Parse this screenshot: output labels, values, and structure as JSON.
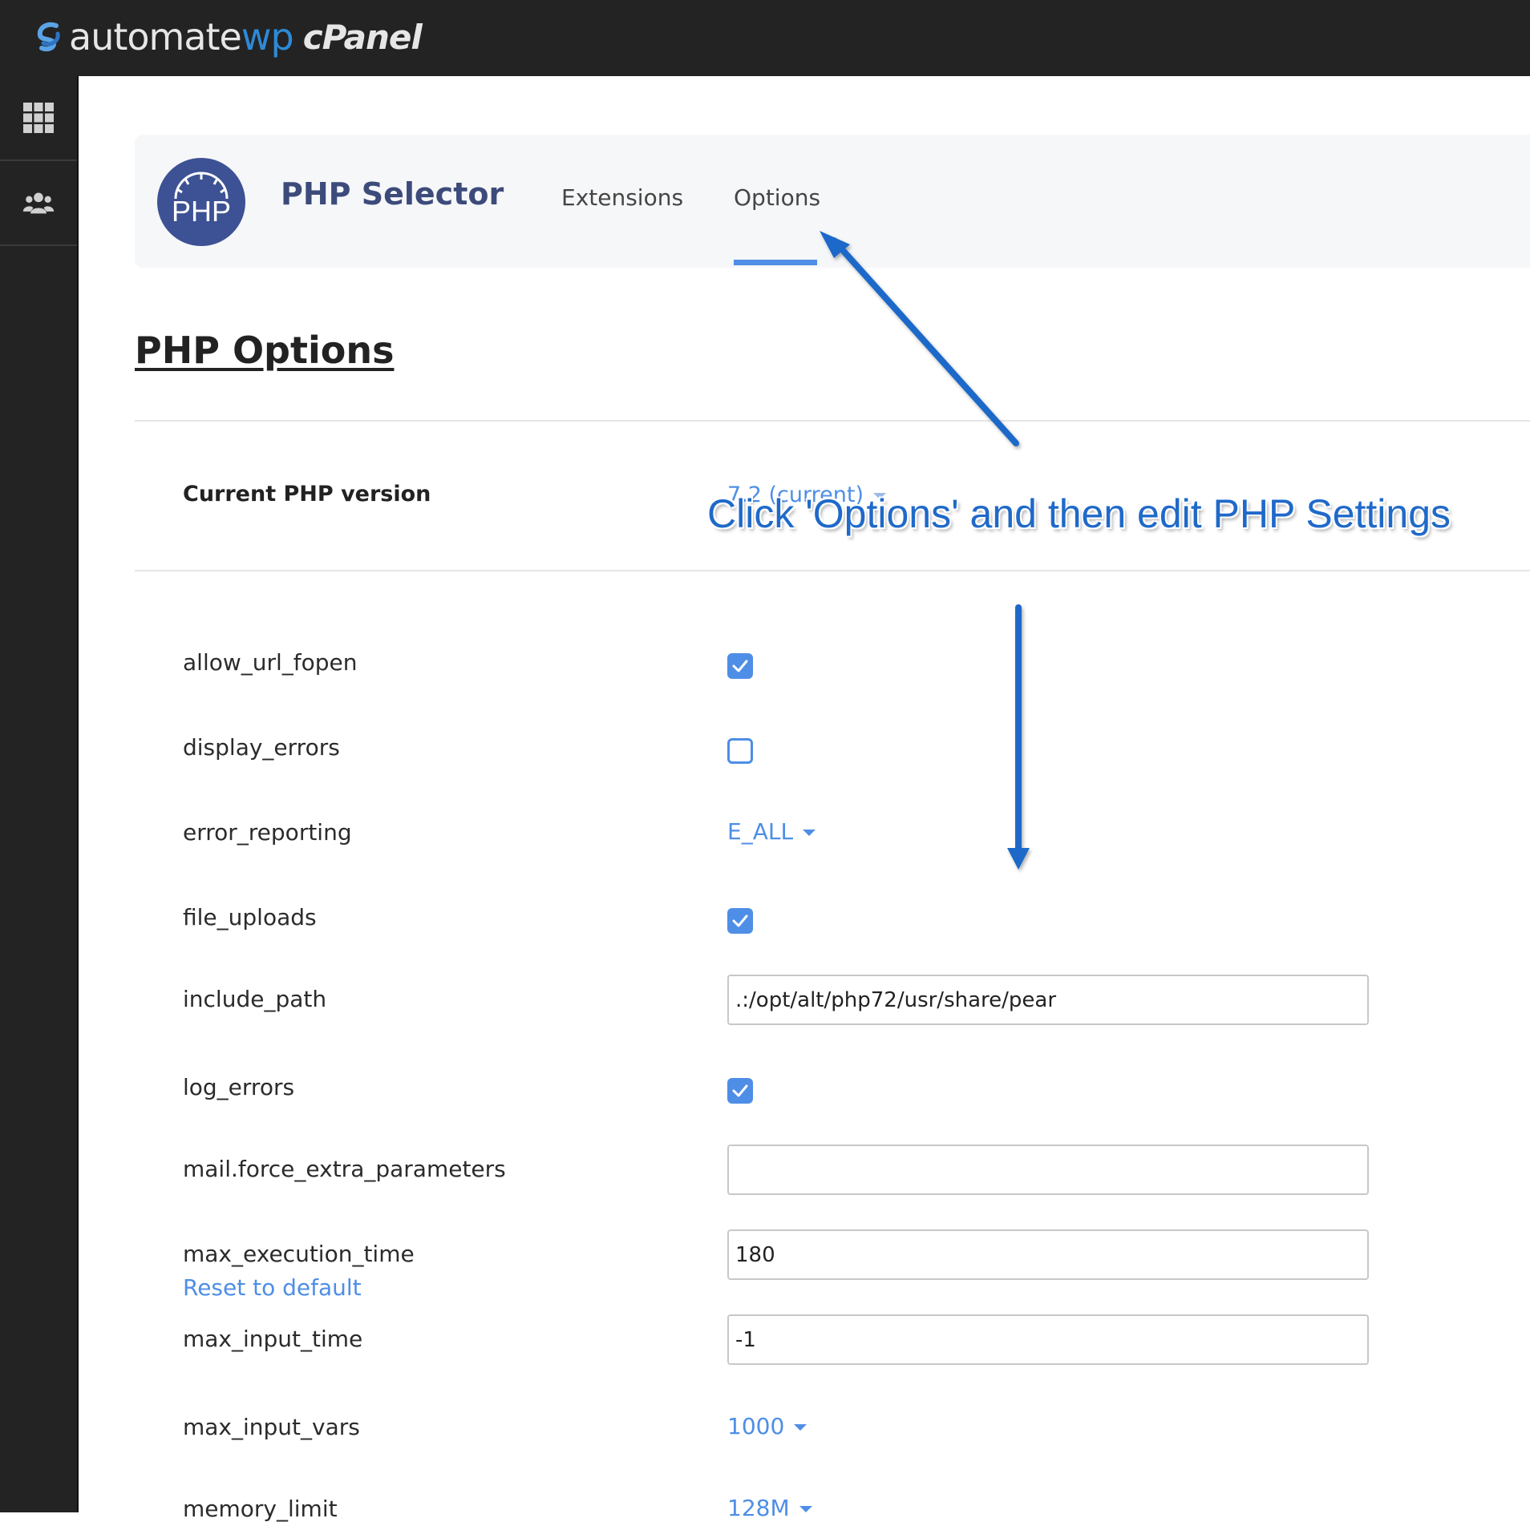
{
  "brand": {
    "part1": "automate",
    "part2": "wp",
    "part3": "cPanel"
  },
  "rail": {
    "items": [
      {
        "icon": "apps-grid-icon"
      },
      {
        "icon": "users-icon"
      }
    ]
  },
  "header": {
    "app_title": "PHP Selector",
    "logo_text": "PHP",
    "tabs": [
      {
        "label": "Extensions"
      },
      {
        "label": "Options",
        "active": true
      }
    ]
  },
  "page": {
    "title": "PHP Options",
    "current_version_label": "Current PHP version",
    "current_version_value": "7.2 (current)"
  },
  "options": {
    "allow_url_fopen": {
      "label": "allow_url_fopen",
      "checked": true
    },
    "display_errors": {
      "label": "display_errors",
      "checked": false
    },
    "error_reporting": {
      "label": "error_reporting",
      "value": "E_ALL"
    },
    "file_uploads": {
      "label": "file_uploads",
      "checked": true
    },
    "include_path": {
      "label": "include_path",
      "value": ".:/opt/alt/php72/usr/share/pear"
    },
    "log_errors": {
      "label": "log_errors",
      "checked": true
    },
    "mail_force_extra_parameters": {
      "label": "mail.force_extra_parameters",
      "value": ""
    },
    "max_execution_time": {
      "label": "max_execution_time",
      "value": "180",
      "reset_label": "Reset to default"
    },
    "max_input_time": {
      "label": "max_input_time",
      "value": "-1"
    },
    "max_input_vars": {
      "label": "max_input_vars",
      "value": "1000"
    },
    "memory_limit": {
      "label": "memory_limit",
      "value": "128M"
    }
  },
  "annotation": {
    "text": "Click 'Options' and then edit PHP Settings",
    "color": "#1f69c9"
  },
  "colors": {
    "accent": "#4e8ee6",
    "topbar": "#232323",
    "brand_blue": "#3c4b7a"
  }
}
